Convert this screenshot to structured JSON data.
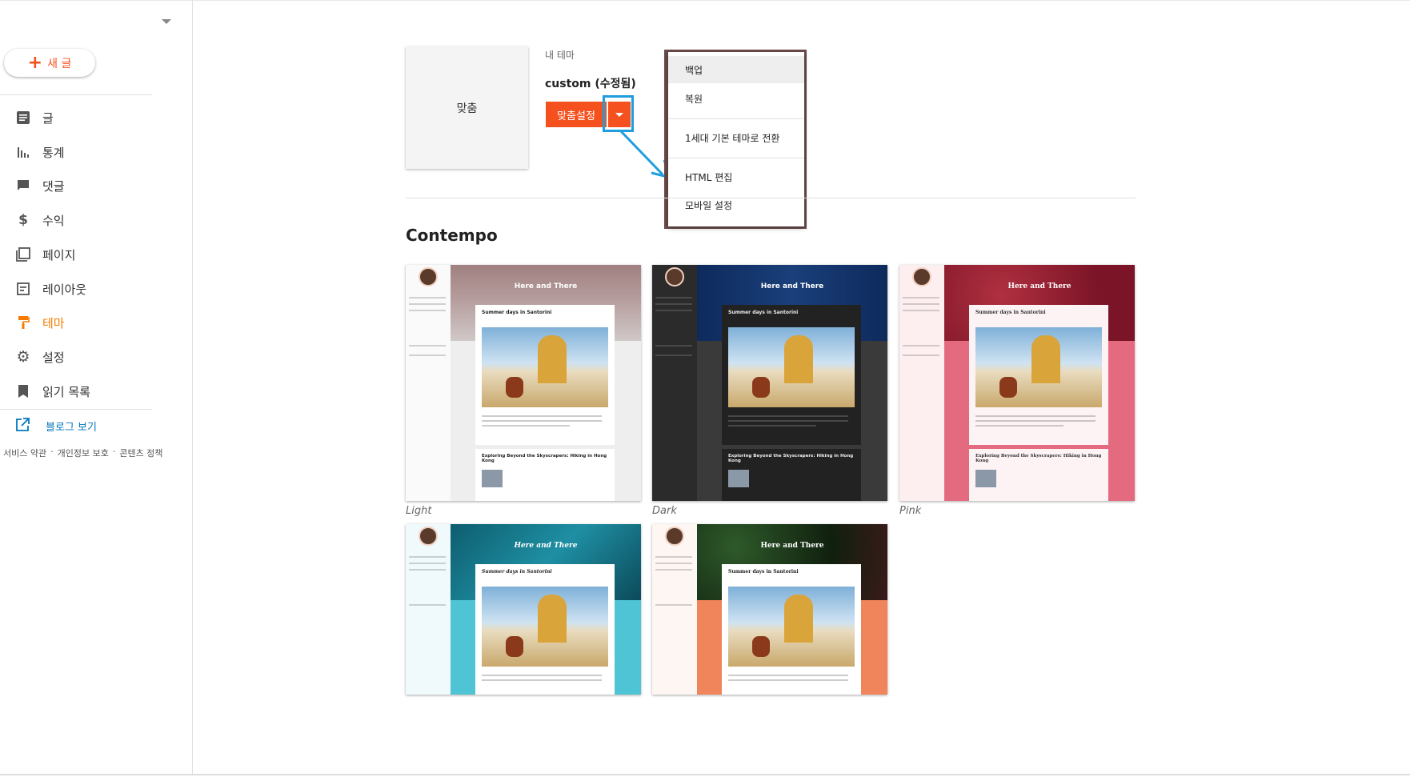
{
  "sidebar": {
    "new_post_label": "새 글",
    "items": [
      {
        "label": "글",
        "icon": "posts-icon"
      },
      {
        "label": "통계",
        "icon": "stats-icon"
      },
      {
        "label": "댓글",
        "icon": "comments-icon"
      },
      {
        "label": "수익",
        "icon": "dollar-icon"
      },
      {
        "label": "페이지",
        "icon": "pages-icon"
      },
      {
        "label": "레이아웃",
        "icon": "layout-icon"
      },
      {
        "label": "테마",
        "icon": "paint-roller-icon",
        "active": true
      },
      {
        "label": "설정",
        "icon": "gear-icon"
      },
      {
        "label": "읽기 목록",
        "icon": "bookmark-icon"
      }
    ],
    "view_blog_label": "블로그 보기",
    "footer_links": [
      "서비스 약관",
      "개인정보 보호",
      "콘텐츠 정책"
    ],
    "footer_separator": "·"
  },
  "current_theme": {
    "thumbnail_label": "맞춤",
    "section_label": "내 테마",
    "name": "custom (수정됨)",
    "customize_label": "맞춤설정"
  },
  "dropdown_menu": {
    "items": [
      "백업",
      "복원",
      "1세대 기본 테마로 전환",
      "HTML 편집",
      "모바일 설정"
    ]
  },
  "theme_section": {
    "title": "Contempo",
    "blog_title": "Here and There",
    "post_title": "Summer days in Santorini",
    "post2_title": "Exploring Beyond the Skyscrapers: Hiking in Hong Kong",
    "themes": [
      "Light",
      "Dark",
      "Pink",
      "",
      ""
    ]
  },
  "colors": {
    "accent": "#f4511e",
    "active_nav": "#f57c00",
    "link": "#0277bd",
    "highlight": "#1e9ddf"
  }
}
